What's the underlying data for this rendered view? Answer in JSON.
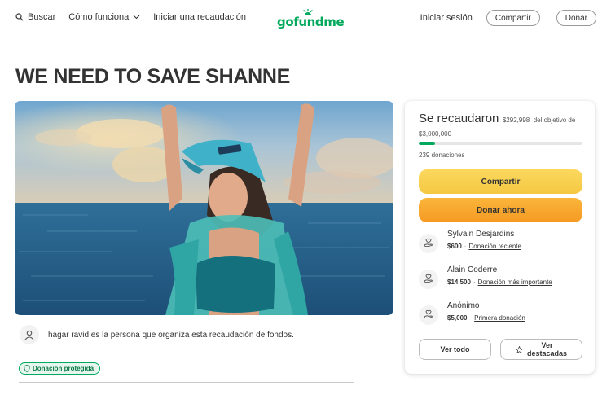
{
  "nav": {
    "search_label": "Buscar",
    "how_label": "Cómo funciona",
    "start_label": "Iniciar una recaudación",
    "logo_text": "gofundme",
    "signin_label": "Iniciar sesión",
    "share_label": "Compartir",
    "donate_label": "Donar"
  },
  "campaign": {
    "title": "WE NEED TO SAVE SHANNE",
    "organizer_text": "hagar ravid es la persona que organiza esta recaudación de fondos.",
    "protected_label": "Donación protegida"
  },
  "card": {
    "raised_label": "Se recaudaron",
    "raised_amount": "$292,998",
    "goal_text": "del objetivo de $3,000,000",
    "progress_fraction": 0.098,
    "donations_count": "239 donaciones",
    "share_button": "Compartir",
    "donate_button": "Donar ahora",
    "donors": [
      {
        "name": "Sylvain Desjardins",
        "amount": "$600",
        "tag": "Donación reciente"
      },
      {
        "name": "Alain Coderre",
        "amount": "$14,500",
        "tag": "Donación más importante"
      },
      {
        "name": "Anónimo",
        "amount": "$5,000",
        "tag": "Primera donación"
      }
    ],
    "see_all_button": "Ver todo",
    "see_top_button_line1": "Ver",
    "see_top_button_line2": "destacadas"
  },
  "colors": {
    "brand_green": "#02a95c",
    "share_yellow": "#f5c842",
    "donate_orange": "#f59a23"
  },
  "icons": [
    "search-icon",
    "chevron-down-icon",
    "logo-sun-icon",
    "user-icon",
    "shield-icon",
    "donation-hand-icon",
    "star-icon"
  ]
}
